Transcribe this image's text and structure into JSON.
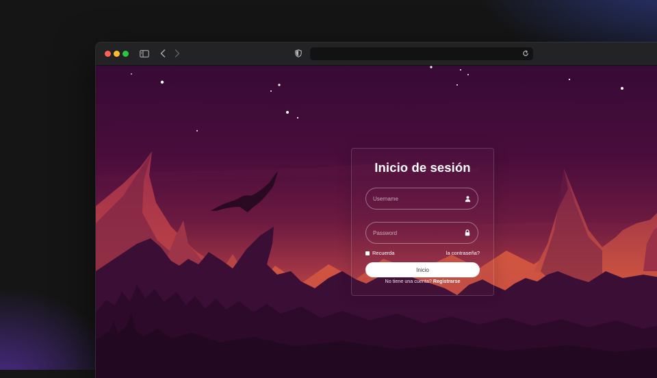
{
  "browser": {
    "url": "",
    "icons": {
      "sidebar": "sidebar-icon",
      "back": "chevron-left-icon",
      "forward": "chevron-right-icon",
      "privacy": "shield-icon",
      "reload": "reload-icon"
    }
  },
  "login": {
    "title": "Inicio de sesión",
    "username_placeholder": "Username",
    "username_value": "",
    "password_placeholder": "Password",
    "password_value": "",
    "remember_label": "Recuerda",
    "forgot_label": "la contraseña?",
    "submit_label": "Inicio",
    "register_prompt": "No tiene una cuenta?",
    "register_link": "Registrarse"
  },
  "colors": {
    "sky_top": "#3a0b38",
    "sky_glow": "#d9523f",
    "mountains": "#3c0f33",
    "button_bg": "#ffffff"
  }
}
